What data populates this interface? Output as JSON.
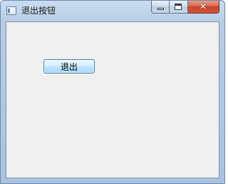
{
  "window": {
    "title": "退出按钮",
    "controls": {
      "close_glyph": "✕"
    }
  },
  "main": {
    "exit_button_label": "退出"
  },
  "icons": {
    "app": "window-app-icon",
    "minimize": "minimize-icon",
    "maximize": "maximize-icon",
    "close": "close-icon"
  },
  "colors": {
    "titlebar": "#b7cde6",
    "client_background": "#f0f0f0",
    "close_button": "#c7432a",
    "exit_button_border": "#3c7fb1"
  }
}
